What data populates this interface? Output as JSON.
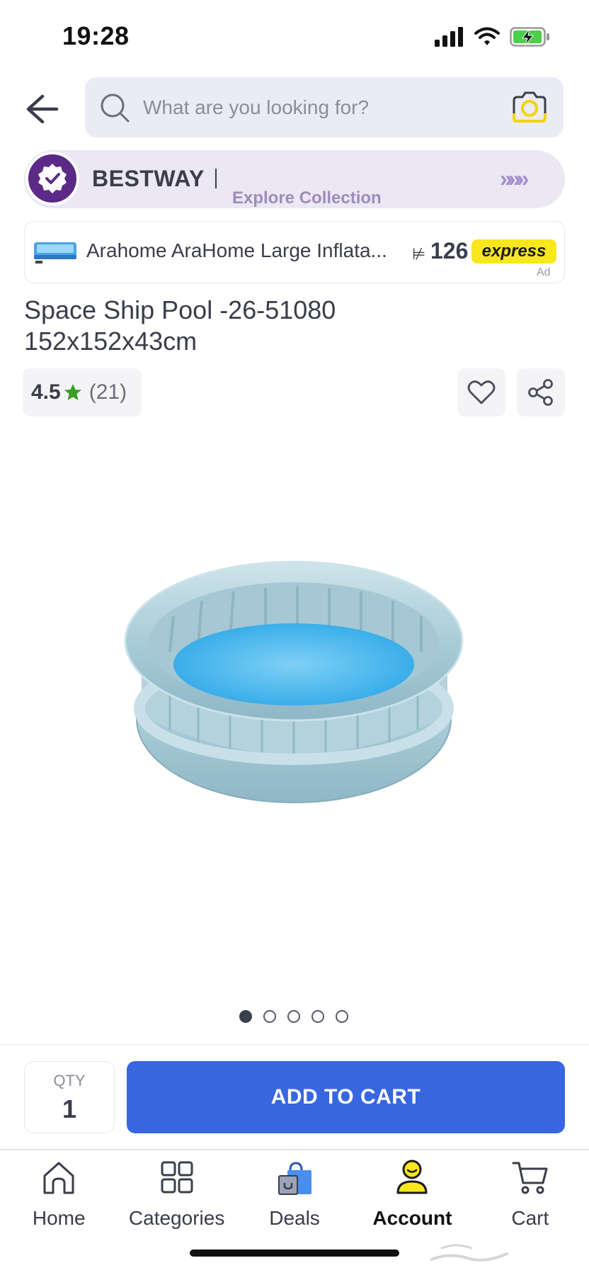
{
  "status_bar": {
    "time": "19:28"
  },
  "search": {
    "placeholder": "What are you looking for?"
  },
  "brand_banner": {
    "name": "BESTWAY",
    "cta": "Explore Collection",
    "arrows": "»»»"
  },
  "ad": {
    "title": "Arahome AraHome Large Inflata...",
    "currency": "⊭",
    "price": "126",
    "badge": "express",
    "label": "Ad"
  },
  "product": {
    "title_line1": "Space Ship Pool -26-51080",
    "title_line2": "152x152x43cm",
    "rating": "4.5",
    "rating_count": "(21)",
    "image_count": 5,
    "active_image": 1
  },
  "purchase": {
    "qty_label": "QTY",
    "qty_value": "1",
    "add_to_cart": "ADD TO CART"
  },
  "nav": {
    "items": [
      {
        "label": "Home",
        "icon": "home-icon",
        "active": false
      },
      {
        "label": "Categories",
        "icon": "categories-icon",
        "active": false
      },
      {
        "label": "Deals",
        "icon": "deals-bag-icon",
        "active": false
      },
      {
        "label": "Account",
        "icon": "account-icon",
        "active": true
      },
      {
        "label": "Cart",
        "icon": "cart-icon",
        "active": false
      }
    ]
  },
  "colors": {
    "primary_button": "#3866df",
    "brand_purple": "#5b2a86",
    "express_yellow": "#f8e71c",
    "rating_star": "#3aa028"
  }
}
